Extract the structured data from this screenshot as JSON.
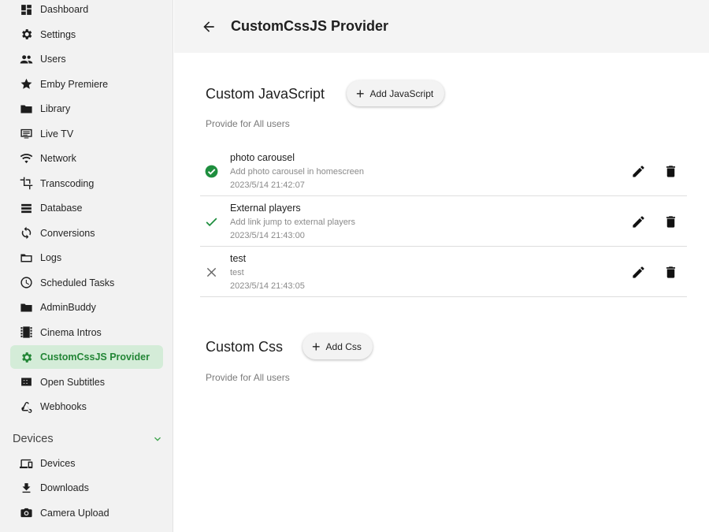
{
  "sidebar": {
    "items": [
      {
        "label": "Dashboard",
        "icon": "dashboard-icon"
      },
      {
        "label": "Settings",
        "icon": "gear-icon"
      },
      {
        "label": "Users",
        "icon": "users-icon"
      },
      {
        "label": "Emby Premiere",
        "icon": "star-icon"
      },
      {
        "label": "Library",
        "icon": "folder-icon"
      },
      {
        "label": "Live TV",
        "icon": "live-tv-icon"
      },
      {
        "label": "Network",
        "icon": "wifi-icon"
      },
      {
        "label": "Transcoding",
        "icon": "crop-icon"
      },
      {
        "label": "Database",
        "icon": "database-icon"
      },
      {
        "label": "Conversions",
        "icon": "sync-icon"
      },
      {
        "label": "Logs",
        "icon": "folder-outline-icon"
      },
      {
        "label": "Scheduled Tasks",
        "icon": "clock-icon"
      },
      {
        "label": "AdminBuddy",
        "icon": "folder-icon"
      },
      {
        "label": "Cinema Intros",
        "icon": "film-icon"
      },
      {
        "label": "CustomCssJS Provider",
        "icon": "gear-icon",
        "active": true
      },
      {
        "label": "Open Subtitles",
        "icon": "closed-caption-icon"
      },
      {
        "label": "Webhooks",
        "icon": "webhook-icon"
      }
    ],
    "devices_section": {
      "label": "Devices",
      "items": [
        {
          "label": "Devices",
          "icon": "devices-icon"
        },
        {
          "label": "Downloads",
          "icon": "download-icon"
        },
        {
          "label": "Camera Upload",
          "icon": "camera-icon"
        }
      ]
    }
  },
  "header": {
    "title": "CustomCssJS Provider"
  },
  "js_section": {
    "title": "Custom JavaScript",
    "add_label": "Add JavaScript",
    "desc": "Provide for All users",
    "items": [
      {
        "name": "photo carousel",
        "desc": "Add photo carousel in homescreen",
        "time": "2023/5/14 21:42:07",
        "status": "enabled"
      },
      {
        "name": "External players",
        "desc": "Add link jump to external players",
        "time": "2023/5/14 21:43:00",
        "status": "check"
      },
      {
        "name": "test",
        "desc": "test",
        "time": "2023/5/14 21:43:05",
        "status": "disabled"
      }
    ]
  },
  "css_section": {
    "title": "Custom Css",
    "add_label": "Add Css",
    "desc": "Provide for All users"
  },
  "colors": {
    "accent": "#238636",
    "active_bg": "#d4ecd8",
    "sidebar_bg": "#f2f2f2",
    "header_bg": "#f4f4f4"
  }
}
